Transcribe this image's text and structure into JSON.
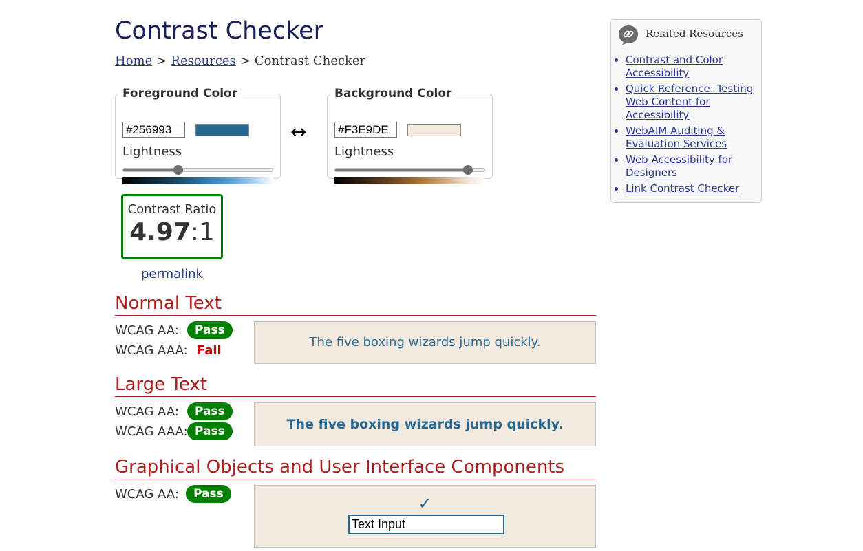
{
  "page": {
    "title": "Contrast Checker"
  },
  "breadcrumb": {
    "home": "Home",
    "resources": "Resources",
    "current": "Contrast Checker",
    "sep": ">"
  },
  "foreground": {
    "legend": "Foreground Color",
    "hex": "#256993",
    "swatch_color": "#256993",
    "lightness_label": "Lightness",
    "lightness": 0.37
  },
  "background": {
    "legend": "Background Color",
    "hex": "#F3E9DE",
    "swatch_color": "#F3E9DE",
    "lightness_label": "Lightness",
    "lightness": 0.89
  },
  "swap_symbol": "↔",
  "contrast": {
    "label": "Contrast Ratio",
    "value": "4.97",
    "suffix": ":1"
  },
  "permalink": "permalink",
  "normal_text": {
    "heading": "Normal Text",
    "aa_label": "WCAG AA:",
    "aa_result": "Pass",
    "aaa_label": "WCAG AAA:",
    "aaa_result": "Fail",
    "sample": "The five boxing wizards jump quickly."
  },
  "large_text": {
    "heading": "Large Text",
    "aa_label": "WCAG AA:",
    "aa_result": "Pass",
    "aaa_label": "WCAG AAA:",
    "aaa_result": "Pass",
    "sample": "The five boxing wizards jump quickly."
  },
  "graphical": {
    "heading": "Graphical Objects and User Interface Components",
    "aa_label": "WCAG AA:",
    "aa_result": "Pass",
    "check": "✓",
    "input_value": "Text Input"
  },
  "sidebar": {
    "heading": "Related Resources",
    "icon": "link-icon",
    "links": [
      {
        "label": "Contrast and Color Accessibility"
      },
      {
        "label": "Quick Reference: Testing Web Content for Accessibility"
      },
      {
        "label": "WebAIM Auditing & Evaluation Services"
      },
      {
        "label": "Web Accessibility for Designers"
      },
      {
        "label": "Link Contrast Checker"
      }
    ]
  },
  "colors": {
    "pass": "#008000",
    "fail": "#CC0000",
    "heading": "#B21E1E",
    "link": "#2B3990",
    "title": "#1A1F5E"
  }
}
